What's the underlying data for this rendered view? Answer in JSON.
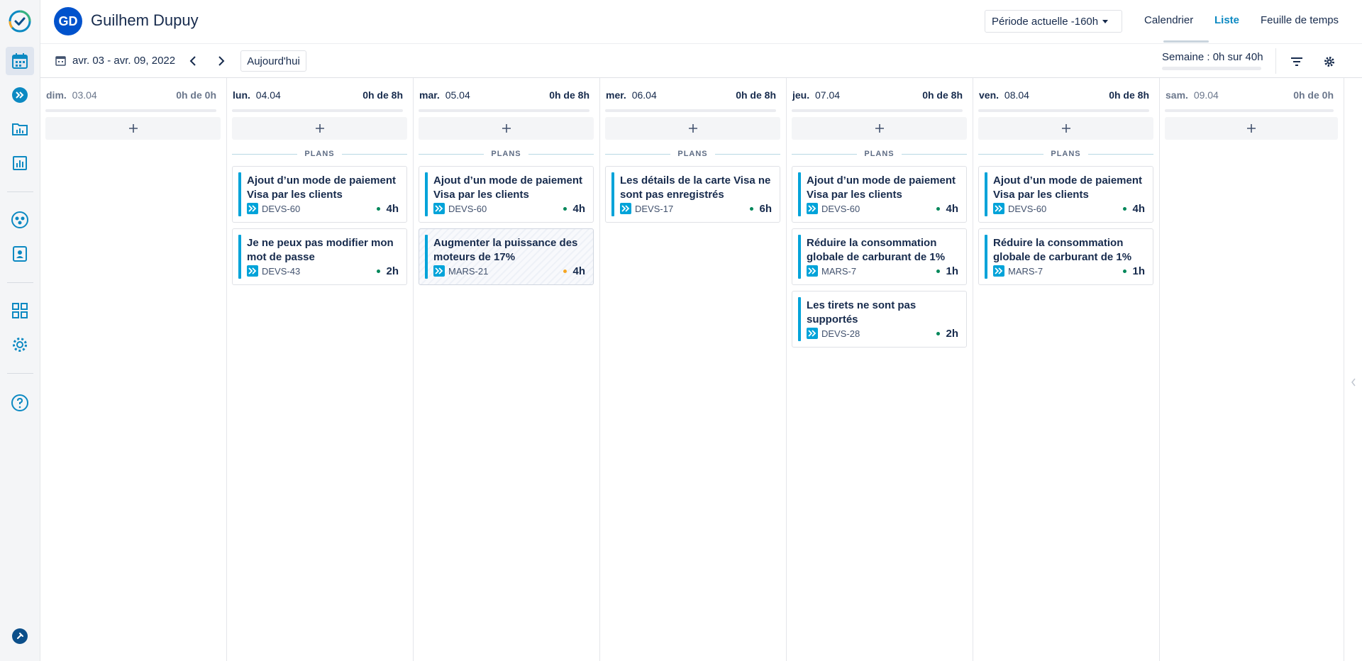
{
  "header": {
    "user_initials": "GD",
    "user_name": "Guilhem Dupuy",
    "period_select": "Période actuelle -160h",
    "tabs": [
      {
        "label": "Calendrier",
        "active": false
      },
      {
        "label": "Liste",
        "active": true
      },
      {
        "label": "Feuille de temps",
        "active": false
      }
    ]
  },
  "toolbar": {
    "date_range": "avr. 03 - avr. 09, 2022",
    "today_label": "Aujourd'hui",
    "week_summary": "Semaine : 0h sur 40h"
  },
  "colors": {
    "accent": "#00a3d9",
    "link": "#0c89c2",
    "status_ok": "#00875a",
    "status_warn": "#f5a623"
  },
  "rail_icons": [
    "logo-icon",
    "calendar-icon",
    "double-chevron-icon",
    "folder-chart-icon",
    "bar-chart-icon",
    "team-icon",
    "contact-icon",
    "grid-icon",
    "gear-icon",
    "help-icon",
    "pin-icon"
  ],
  "plans_label": "PLANS",
  "days": [
    {
      "name": "dim.",
      "date": "03.04",
      "hours": "0h de 0h",
      "weekend": true,
      "plans": []
    },
    {
      "name": "lun.",
      "date": "04.04",
      "hours": "0h de 8h",
      "weekend": false,
      "plans": [
        {
          "title": "Ajout d’un mode de paiement Visa par les clients",
          "issue": "DEVS-60",
          "hours": "4h",
          "status": "ok"
        },
        {
          "title": "Je ne peux pas modifier mon mot de passe",
          "issue": "DEVS-43",
          "hours": "2h",
          "status": "ok"
        }
      ]
    },
    {
      "name": "mar.",
      "date": "05.04",
      "hours": "0h de 8h",
      "weekend": false,
      "plans": [
        {
          "title": "Ajout d’un mode de paiement Visa par les clients",
          "issue": "DEVS-60",
          "hours": "4h",
          "status": "ok"
        },
        {
          "title": "Augmenter la puissance des moteurs de 17%",
          "issue": "MARS-21",
          "hours": "4h",
          "status": "warn",
          "hatched": true
        }
      ]
    },
    {
      "name": "mer.",
      "date": "06.04",
      "hours": "0h de 8h",
      "weekend": false,
      "plans": [
        {
          "title": "Les détails de la carte Visa ne sont pas enregistrés",
          "issue": "DEVS-17",
          "hours": "6h",
          "status": "ok"
        }
      ]
    },
    {
      "name": "jeu.",
      "date": "07.04",
      "hours": "0h de 8h",
      "weekend": false,
      "plans": [
        {
          "title": "Ajout d’un mode de paiement Visa par les clients",
          "issue": "DEVS-60",
          "hours": "4h",
          "status": "ok"
        },
        {
          "title": "Réduire la consommation globale de carburant de 1%",
          "issue": "MARS-7",
          "hours": "1h",
          "status": "ok"
        },
        {
          "title": "Les tirets ne sont pas supportés",
          "issue": "DEVS-28",
          "hours": "2h",
          "status": "ok"
        }
      ]
    },
    {
      "name": "ven.",
      "date": "08.04",
      "hours": "0h de 8h",
      "weekend": false,
      "plans": [
        {
          "title": "Ajout d’un mode de paiement Visa par les clients",
          "issue": "DEVS-60",
          "hours": "4h",
          "status": "ok"
        },
        {
          "title": "Réduire la consommation globale de carburant de 1%",
          "issue": "MARS-7",
          "hours": "1h",
          "status": "ok"
        }
      ]
    },
    {
      "name": "sam.",
      "date": "09.04",
      "hours": "0h de 0h",
      "weekend": true,
      "plans": []
    }
  ]
}
